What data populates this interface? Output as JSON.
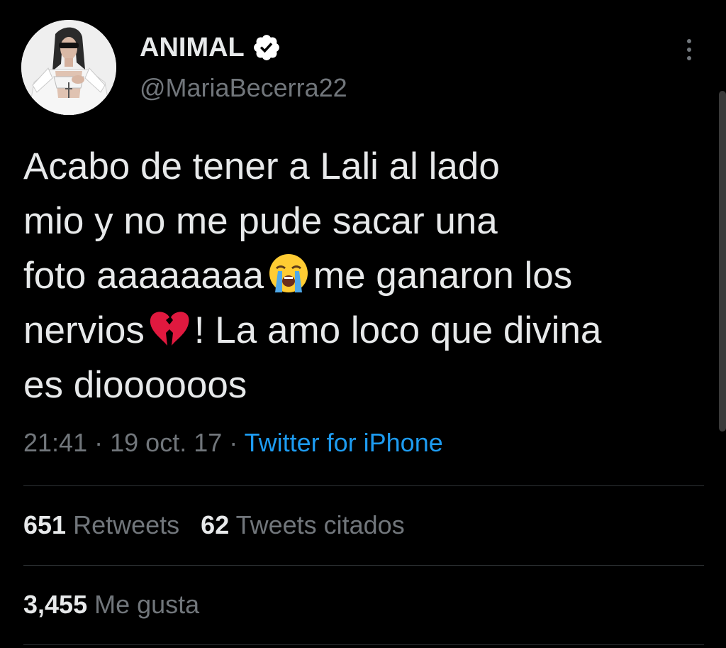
{
  "tweet": {
    "display_name": "ANIMAL",
    "handle": "@MariaBecerra22",
    "verified_icon": "verified-badge-icon",
    "text_lines": [
      "Acabo de tener a Lali al lado",
      "mio y no me pude sacar una",
      "foto aaaaaaaa",
      "me ganaron los",
      "nervios",
      "! La amo loco que divina",
      "es dioooooos"
    ],
    "emojis": [
      "loudly-crying-face-icon",
      "broken-heart-icon"
    ],
    "time": "21:41",
    "separator": "·",
    "date": "19 oct. 17",
    "source": "Twitter for iPhone"
  },
  "stats": {
    "retweets_count": "651",
    "retweets_label": "Retweets",
    "quotes_count": "62",
    "quotes_label": "Tweets citados",
    "likes_count": "3,455",
    "likes_label": "Me gusta"
  },
  "colors": {
    "background": "#000000",
    "text": "#e7e9ea",
    "secondary": "#71767b",
    "link": "#1d9bf0",
    "divider": "#2f3336",
    "verified": "#ffffff"
  }
}
